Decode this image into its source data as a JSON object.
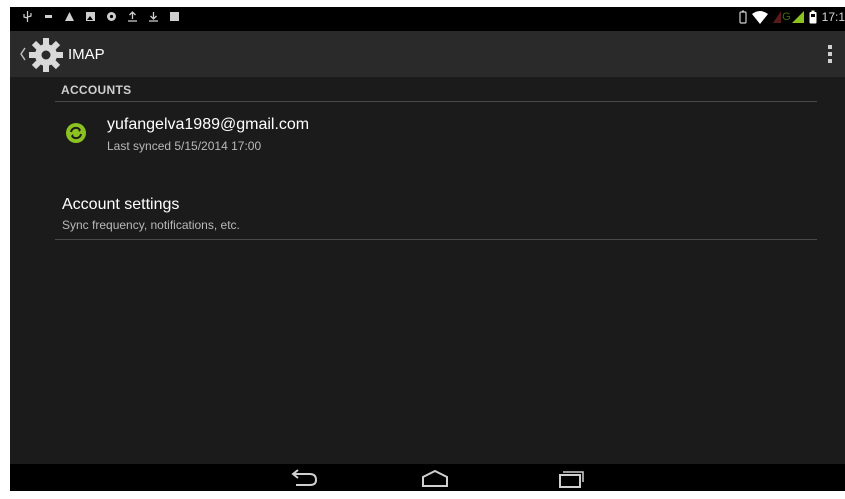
{
  "status_bar": {
    "time": "17:1",
    "left_icons": [
      "usb-icon",
      "sd-card-icon",
      "warning-icon",
      "image-icon",
      "sync-notification-icon",
      "upload-icon",
      "download-icon",
      "media-icon"
    ],
    "right_icons": [
      "battery-saver-icon",
      "wifi-icon",
      "signal-icon",
      "battery-icon"
    ],
    "network_label": "G"
  },
  "action_bar": {
    "title": "IMAP",
    "app_icon": "gear-icon",
    "overflow_icon": "overflow-menu-icon"
  },
  "accounts": {
    "header": "ACCOUNTS",
    "items": [
      {
        "email": "yufangelva1989@gmail.com",
        "last_synced": "Last synced 5/15/2014 17:00",
        "icon": "sync-icon",
        "icon_color": "#8cc220"
      }
    ]
  },
  "account_settings": {
    "title": "Account settings",
    "subtitle": "Sync frequency, notifications, etc."
  },
  "nav_bar": {
    "buttons": [
      "back-icon",
      "home-icon",
      "recents-icon"
    ]
  },
  "colors": {
    "background": "#1b1b1b",
    "action_bar": "#2a2a2a",
    "accent_green": "#8cc220",
    "divider": "#4a4a4a"
  }
}
